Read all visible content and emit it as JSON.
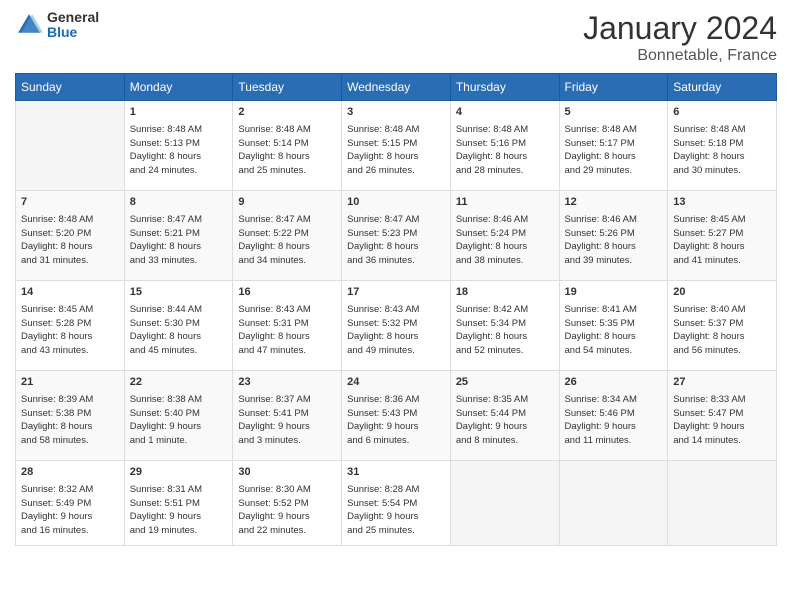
{
  "header": {
    "logo": {
      "line1": "General",
      "line2": "Blue"
    },
    "title": "January 2024",
    "subtitle": "Bonnetable, France"
  },
  "calendar": {
    "days": [
      "Sunday",
      "Monday",
      "Tuesday",
      "Wednesday",
      "Thursday",
      "Friday",
      "Saturday"
    ],
    "weeks": [
      [
        {
          "day": "",
          "content": ""
        },
        {
          "day": "1",
          "content": "Sunrise: 8:48 AM\nSunset: 5:13 PM\nDaylight: 8 hours\nand 24 minutes."
        },
        {
          "day": "2",
          "content": "Sunrise: 8:48 AM\nSunset: 5:14 PM\nDaylight: 8 hours\nand 25 minutes."
        },
        {
          "day": "3",
          "content": "Sunrise: 8:48 AM\nSunset: 5:15 PM\nDaylight: 8 hours\nand 26 minutes."
        },
        {
          "day": "4",
          "content": "Sunrise: 8:48 AM\nSunset: 5:16 PM\nDaylight: 8 hours\nand 28 minutes."
        },
        {
          "day": "5",
          "content": "Sunrise: 8:48 AM\nSunset: 5:17 PM\nDaylight: 8 hours\nand 29 minutes."
        },
        {
          "day": "6",
          "content": "Sunrise: 8:48 AM\nSunset: 5:18 PM\nDaylight: 8 hours\nand 30 minutes."
        }
      ],
      [
        {
          "day": "7",
          "content": "Sunrise: 8:48 AM\nSunset: 5:20 PM\nDaylight: 8 hours\nand 31 minutes."
        },
        {
          "day": "8",
          "content": "Sunrise: 8:47 AM\nSunset: 5:21 PM\nDaylight: 8 hours\nand 33 minutes."
        },
        {
          "day": "9",
          "content": "Sunrise: 8:47 AM\nSunset: 5:22 PM\nDaylight: 8 hours\nand 34 minutes."
        },
        {
          "day": "10",
          "content": "Sunrise: 8:47 AM\nSunset: 5:23 PM\nDaylight: 8 hours\nand 36 minutes."
        },
        {
          "day": "11",
          "content": "Sunrise: 8:46 AM\nSunset: 5:24 PM\nDaylight: 8 hours\nand 38 minutes."
        },
        {
          "day": "12",
          "content": "Sunrise: 8:46 AM\nSunset: 5:26 PM\nDaylight: 8 hours\nand 39 minutes."
        },
        {
          "day": "13",
          "content": "Sunrise: 8:45 AM\nSunset: 5:27 PM\nDaylight: 8 hours\nand 41 minutes."
        }
      ],
      [
        {
          "day": "14",
          "content": "Sunrise: 8:45 AM\nSunset: 5:28 PM\nDaylight: 8 hours\nand 43 minutes."
        },
        {
          "day": "15",
          "content": "Sunrise: 8:44 AM\nSunset: 5:30 PM\nDaylight: 8 hours\nand 45 minutes."
        },
        {
          "day": "16",
          "content": "Sunrise: 8:43 AM\nSunset: 5:31 PM\nDaylight: 8 hours\nand 47 minutes."
        },
        {
          "day": "17",
          "content": "Sunrise: 8:43 AM\nSunset: 5:32 PM\nDaylight: 8 hours\nand 49 minutes."
        },
        {
          "day": "18",
          "content": "Sunrise: 8:42 AM\nSunset: 5:34 PM\nDaylight: 8 hours\nand 52 minutes."
        },
        {
          "day": "19",
          "content": "Sunrise: 8:41 AM\nSunset: 5:35 PM\nDaylight: 8 hours\nand 54 minutes."
        },
        {
          "day": "20",
          "content": "Sunrise: 8:40 AM\nSunset: 5:37 PM\nDaylight: 8 hours\nand 56 minutes."
        }
      ],
      [
        {
          "day": "21",
          "content": "Sunrise: 8:39 AM\nSunset: 5:38 PM\nDaylight: 8 hours\nand 58 minutes."
        },
        {
          "day": "22",
          "content": "Sunrise: 8:38 AM\nSunset: 5:40 PM\nDaylight: 9 hours\nand 1 minute."
        },
        {
          "day": "23",
          "content": "Sunrise: 8:37 AM\nSunset: 5:41 PM\nDaylight: 9 hours\nand 3 minutes."
        },
        {
          "day": "24",
          "content": "Sunrise: 8:36 AM\nSunset: 5:43 PM\nDaylight: 9 hours\nand 6 minutes."
        },
        {
          "day": "25",
          "content": "Sunrise: 8:35 AM\nSunset: 5:44 PM\nDaylight: 9 hours\nand 8 minutes."
        },
        {
          "day": "26",
          "content": "Sunrise: 8:34 AM\nSunset: 5:46 PM\nDaylight: 9 hours\nand 11 minutes."
        },
        {
          "day": "27",
          "content": "Sunrise: 8:33 AM\nSunset: 5:47 PM\nDaylight: 9 hours\nand 14 minutes."
        }
      ],
      [
        {
          "day": "28",
          "content": "Sunrise: 8:32 AM\nSunset: 5:49 PM\nDaylight: 9 hours\nand 16 minutes."
        },
        {
          "day": "29",
          "content": "Sunrise: 8:31 AM\nSunset: 5:51 PM\nDaylight: 9 hours\nand 19 minutes."
        },
        {
          "day": "30",
          "content": "Sunrise: 8:30 AM\nSunset: 5:52 PM\nDaylight: 9 hours\nand 22 minutes."
        },
        {
          "day": "31",
          "content": "Sunrise: 8:28 AM\nSunset: 5:54 PM\nDaylight: 9 hours\nand 25 minutes."
        },
        {
          "day": "",
          "content": ""
        },
        {
          "day": "",
          "content": ""
        },
        {
          "day": "",
          "content": ""
        }
      ]
    ]
  }
}
